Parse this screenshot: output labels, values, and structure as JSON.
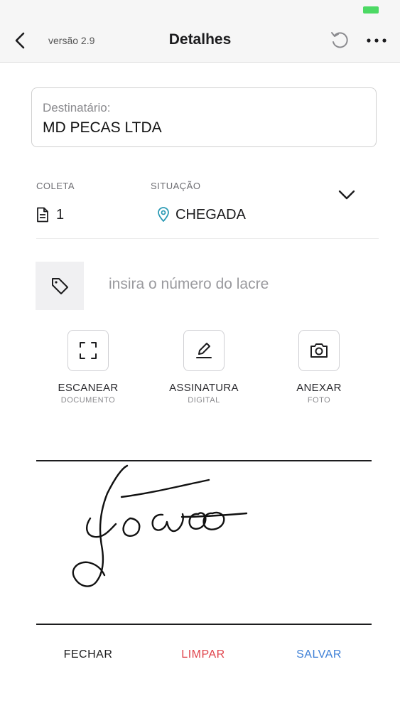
{
  "header": {
    "version": "versão 2.9",
    "title": "Detalhes"
  },
  "recipient": {
    "label": "Destinatário:",
    "value": "MD PECAS LTDA"
  },
  "collection": {
    "label": "COLETA",
    "value": "1"
  },
  "status": {
    "label": "SITUAÇÃO",
    "value": "CHEGADA",
    "accent_color": "#2d9bb5"
  },
  "seal": {
    "placeholder": "insira o número do lacre"
  },
  "actions": [
    {
      "title": "ESCANEAR",
      "subtitle": "DOCUMENTO",
      "icon": "scan-icon"
    },
    {
      "title": "ASSINATURA",
      "subtitle": "DIGITAL",
      "icon": "pen-icon"
    },
    {
      "title": "ANEXAR",
      "subtitle": "FOTO",
      "icon": "camera-icon"
    }
  ],
  "footer": {
    "close_label": "FECHAR",
    "clear_label": "LIMPAR",
    "save_label": "SALVAR"
  },
  "colors": {
    "battery": "#4cd964",
    "clear": "#e0434b",
    "save": "#3d7fd6"
  }
}
